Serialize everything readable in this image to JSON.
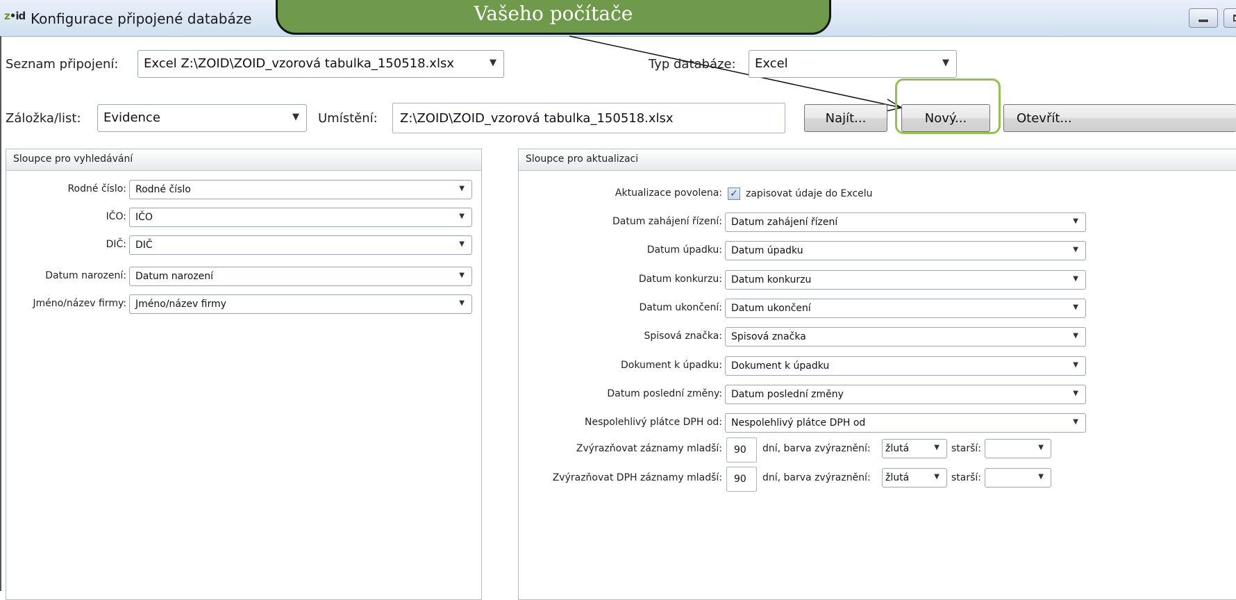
{
  "window": {
    "title": "Konfigurace připojené databáze",
    "logo_prefix": "z",
    "logo_rest": "•id"
  },
  "callout": {
    "text": "Vašeho počítače"
  },
  "top": {
    "connection_label": "Seznam připojení:",
    "connection_value": "Excel Z:\\ZOID\\ZOID_vzorová tabulka_150518.xlsx",
    "db_type_label": "Typ databáze:",
    "db_type_value": "Excel",
    "sheet_label": "Záložka/list:",
    "sheet_value": "Evidence",
    "location_label": "Umístění:",
    "location_value": "Z:\\ZOID\\ZOID_vzorová tabulka_150518.xlsx",
    "find_button": "Najít...",
    "new_button": "Nový...",
    "open_button": "Otevřít..."
  },
  "search_columns": {
    "header": "Sloupce pro vyhledávání",
    "rows": [
      {
        "label": "Rodné číslo:",
        "value": "Rodné číslo"
      },
      {
        "label": "IČO:",
        "value": "IČO"
      },
      {
        "label": "DIČ:",
        "value": "DIČ"
      },
      {
        "label": "Datum narození:",
        "value": "Datum narození"
      },
      {
        "label": "Jméno/název firmy:",
        "value": "Jméno/název firmy"
      }
    ]
  },
  "update_columns": {
    "header": "Sloupce pro aktualizaci",
    "enabled_label": "Aktualizace povolena:",
    "enabled_checked": true,
    "enabled_text": "zapisovat údaje do Excelu",
    "rows": [
      {
        "label": "Datum zahájení řízení:",
        "value": "Datum zahájení řízení"
      },
      {
        "label": "Datum úpadku:",
        "value": "Datum úpadku"
      },
      {
        "label": "Datum konkurzu:",
        "value": "Datum konkurzu"
      },
      {
        "label": "Datum ukončení:",
        "value": "Datum ukončení"
      },
      {
        "label": "Spisová značka:",
        "value": "Spisová značka"
      },
      {
        "label": "Dokument k úpadku:",
        "value": "Dokument k úpadku"
      },
      {
        "label": "Datum poslední změny:",
        "value": "Datum poslední změny"
      },
      {
        "label": "Nespolehlivý plátce DPH od:",
        "value": "Nespolehlivý plátce DPH od"
      }
    ],
    "highlight_rows": [
      {
        "label": "Zvýrazňovat záznamy mladší:",
        "days": "90",
        "days_text": "dní, barva zvýraznění:",
        "color": "žlutá",
        "older_label": "starší:",
        "older_value": ""
      },
      {
        "label": "Zvýrazňovat DPH záznamy mladší:",
        "days": "90",
        "days_text": "dní, barva zvýraznění:",
        "color": "žlutá",
        "older_label": "starší:",
        "older_value": ""
      }
    ]
  }
}
